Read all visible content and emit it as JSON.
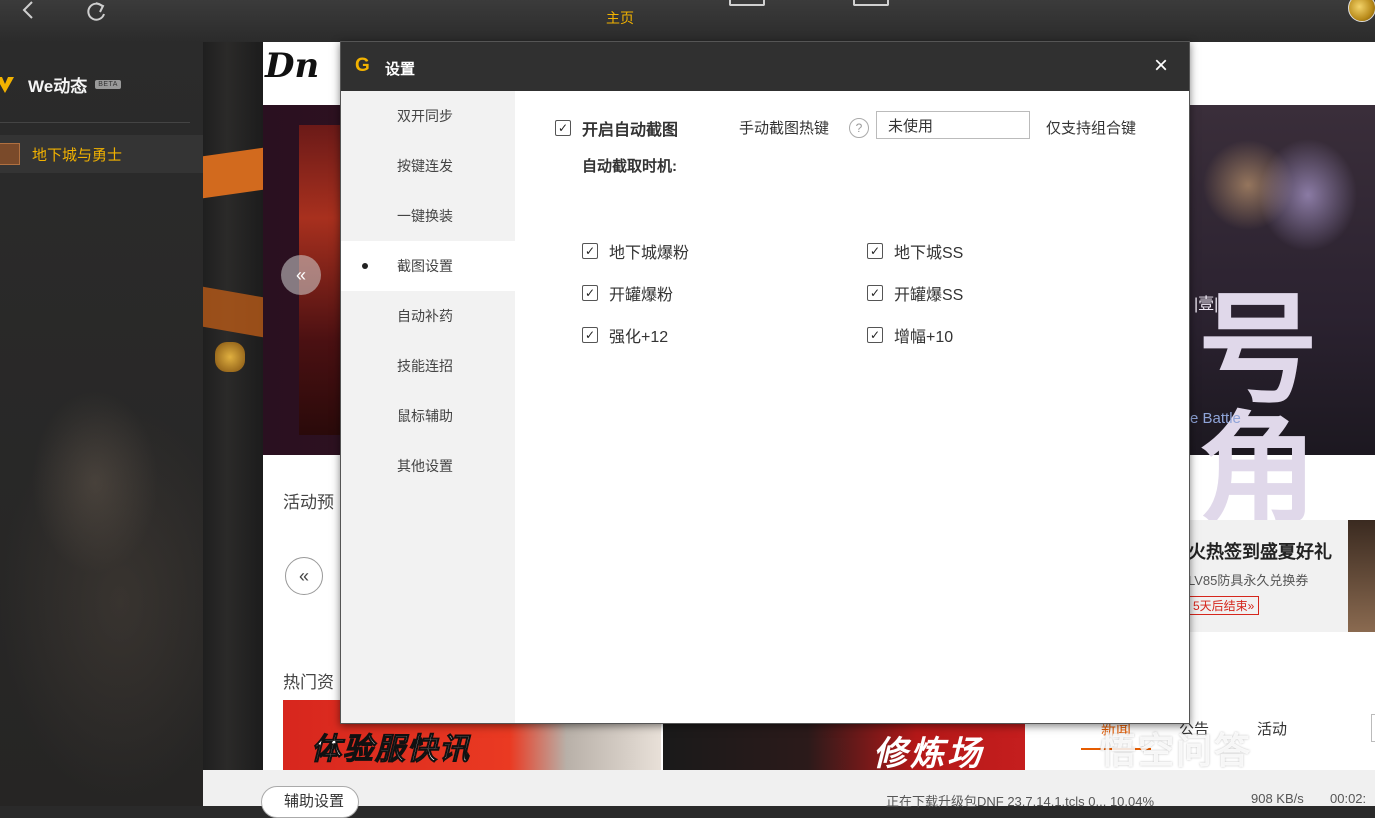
{
  "topbar": {
    "back_icon": "chevron-left-icon",
    "refresh_icon": "refresh-icon",
    "home_label": "主页"
  },
  "sidebar": {
    "brand_name": "We动态",
    "beta_badge": "BETA",
    "game_label": "地下城与勇士"
  },
  "content": {
    "logo_text": "Dn",
    "banner_right_yi": "|壹|",
    "banner_right_glyph": "号角",
    "banner_right_sub": "e Battle",
    "activity_title": "活动预",
    "hot_title": "热门资",
    "promo": {
      "title": "火热签到盛夏好礼",
      "subtitle": "LV85防具永久兑换券",
      "countdown": "5天后结束»"
    },
    "tabs": [
      "新闻",
      "公告",
      "活动"
    ],
    "thumb1_text": "体验服快讯",
    "thumb2_text": "修炼场"
  },
  "statusbar": {
    "assist_button": "辅助设置",
    "download_text": "正在下载升级包DNF 23.7.14.1.tcls 0... 10.04%",
    "speed": "908 KB/s",
    "time": "00:02:"
  },
  "watermark": "悟空问答",
  "dialog": {
    "title": "设置",
    "close_symbol": "×",
    "menu": [
      {
        "label": "双开同步",
        "active": false
      },
      {
        "label": "按键连发",
        "active": false
      },
      {
        "label": "一键换装",
        "active": false
      },
      {
        "label": "截图设置",
        "active": true
      },
      {
        "label": "自动补药",
        "active": false
      },
      {
        "label": "技能连招",
        "active": false
      },
      {
        "label": "鼠标辅助",
        "active": false
      },
      {
        "label": "其他设置",
        "active": false
      }
    ],
    "screenshot": {
      "auto_label": "开启自动截图",
      "auto_checked": true,
      "hotkey_label": "手动截图热键",
      "hotkey_value": "未使用",
      "hotkey_note": "仅支持组合键",
      "timing_label": "自动截取时机:",
      "options": [
        {
          "label": "地下城爆粉",
          "checked": true
        },
        {
          "label": "地下城SS",
          "checked": true
        },
        {
          "label": "开罐爆粉",
          "checked": true
        },
        {
          "label": "开罐爆SS",
          "checked": true
        },
        {
          "label": "强化+12",
          "checked": true
        },
        {
          "label": "增幅+10",
          "checked": true
        }
      ]
    }
  },
  "colors": {
    "accent": "#f2b200",
    "titlebar": "#303030",
    "tab_active": "#e65c00"
  }
}
